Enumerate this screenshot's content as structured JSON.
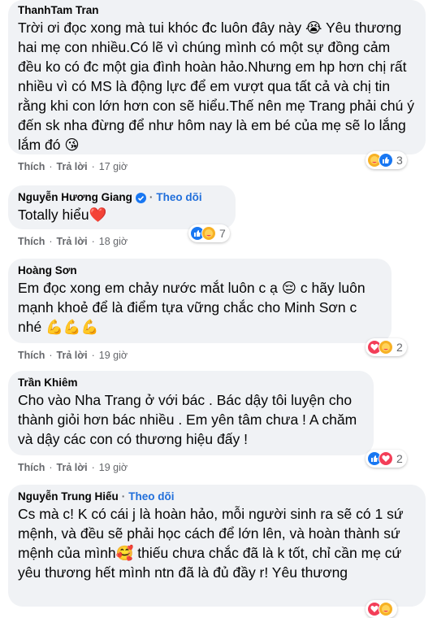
{
  "actions": {
    "like_label": "Thích",
    "reply_label": "Trả lời"
  },
  "comments": [
    {
      "author": "ThanhTam Tran",
      "text": "Trời ơi đọc xong mà tui khóc đc luôn đây này 😭 Yêu thương hai mẹ con nhiều.Có lẽ vì chúng mình có một sự đồng cảm đều ko có đc một gia đình hoàn hảo.Nhưng em hp hơn chị rất nhiều vì có MS là động lực để em vượt qua tất cả và chị tin rằng khi con lớn hơn con sẽ hiểu.Thế nên mẹ Trang phải chú ý đến sk nha đừng để như hôm nay là em bé của mẹ sẽ lo lắng lắm đó 😘",
      "time": "17 giờ",
      "reactions": [
        "care",
        "like"
      ],
      "reaction_count": "3"
    },
    {
      "author": "Nguyễn Hương Giang",
      "verified": true,
      "follow": "Theo dõi",
      "text": "Totally hiểu❤️",
      "time": "18 giờ",
      "reactions": [
        "like",
        "care"
      ],
      "reaction_count": "7"
    },
    {
      "author": "Hoàng Sơn",
      "text": "Em đọc xong em chảy nước mắt luôn c ạ 😔 c hãy luôn mạnh khoẻ để là điểm tựa vững chắc cho Minh Sơn c nhé 💪💪💪",
      "time": "19 giờ",
      "reactions": [
        "love",
        "care"
      ],
      "reaction_count": "2"
    },
    {
      "author": "Trần Khiêm",
      "text": "Cho vào Nha Trang ở với bác . Bác dậy tôi luyện cho thành giỏi hơn bác nhiều . Em yên tâm chưa ! A chăm và dậy các con có thương hiệu đấy !",
      "time": "19 giờ",
      "reactions": [
        "like",
        "love"
      ],
      "reaction_count": "2"
    },
    {
      "author": "Nguyễn Trung Hiếu",
      "follow": "Theo dõi",
      "text": "Cs mà c! K có cái j là hoàn hảo, mỗi người sinh ra sẽ có 1 sứ mệnh, và đều sẽ phải học cách để lớn lên, và hoàn thành sứ mệnh của mình🥰 thiếu chưa chắc đã là k tốt, chỉ cần mẹ cứ yêu thương hết mình ntn đã là đủ đầy r! Yêu thương",
      "reactions": [
        "love",
        "care"
      ]
    }
  ]
}
